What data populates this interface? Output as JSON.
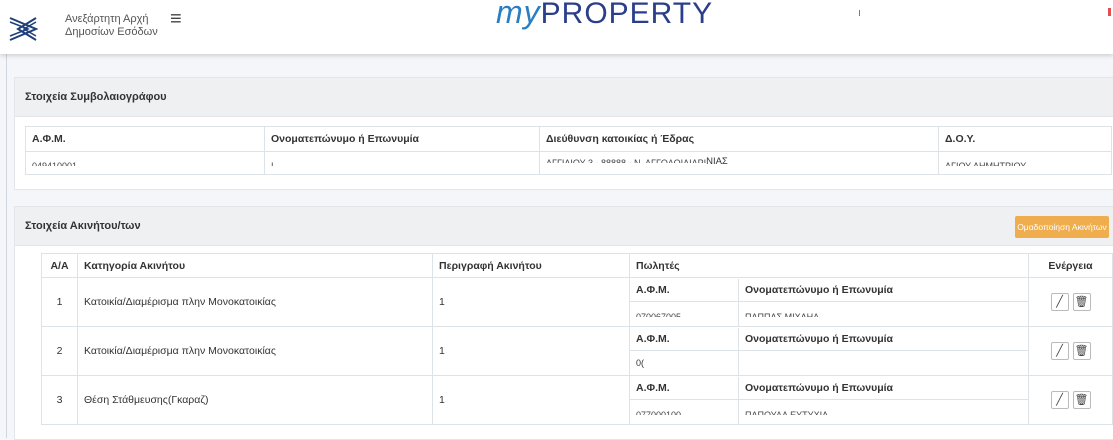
{
  "header": {
    "org_line1": "Ανεξάρτητη Αρχή",
    "org_line2": "Δημοσίων Εσόδων",
    "brand_my": "my",
    "brand_rest": "PROPERTY"
  },
  "notary": {
    "title": "Στοιχεία Συμβολαιογράφου",
    "columns": [
      "Α.Φ.Μ.",
      "Ονοματεπώνυμο ή Επωνυμία",
      "Διεύθυνση κατοικίας ή Έδρας",
      "Δ.Ο.Υ."
    ],
    "row": {
      "afm": "049410001",
      "name": "Ι",
      "address_clipped": "ΑΓΓΙΑΙΟΥ 3 - 88888 - Ν. ΑΓΓΟΛΟΙΑΙΑΡΙ",
      "address_tail": "ΝΙΑΣ",
      "doy": "ΑΓΙΟΥ ΔΗΜΗΤΡΙΟΥ"
    }
  },
  "properties": {
    "title": "Στοιχεία Ακινήτου/των",
    "group_button": "Ομαδοποίηση Ακινήτων",
    "add_button": "+",
    "columns": {
      "aa": "Α/Α",
      "category": "Κατηγορία Ακινήτου",
      "description": "Περιγραφή Ακινήτου",
      "sellers": "Πωλητές",
      "actions": "Ενέργεια"
    },
    "seller_columns": [
      "Α.Φ.Μ.",
      "Ονοματεπώνυμο ή Επωνυμία"
    ],
    "rows": [
      {
        "aa": "1",
        "category": "Κατοικία/Διαμέρισμα πλην Μονοκατοικίας",
        "description": "1",
        "seller_afm": "070067005",
        "seller_name": "ΠΑΠΠΑΣ ΜΙΧΑΗΛ"
      },
      {
        "aa": "2",
        "category": "Κατοικία/Διαμέρισμα πλην Μονοκατοικίας",
        "description": "1",
        "seller_afm": "0(",
        "seller_name": ""
      },
      {
        "aa": "3",
        "category": "Θέση Στάθμευσης(Γκαραζ)",
        "description": "1",
        "seller_afm": "077000100",
        "seller_name": "ΠΑΠΟΥΛΑ ΕΥΤΥΧΙΑ"
      }
    ]
  }
}
